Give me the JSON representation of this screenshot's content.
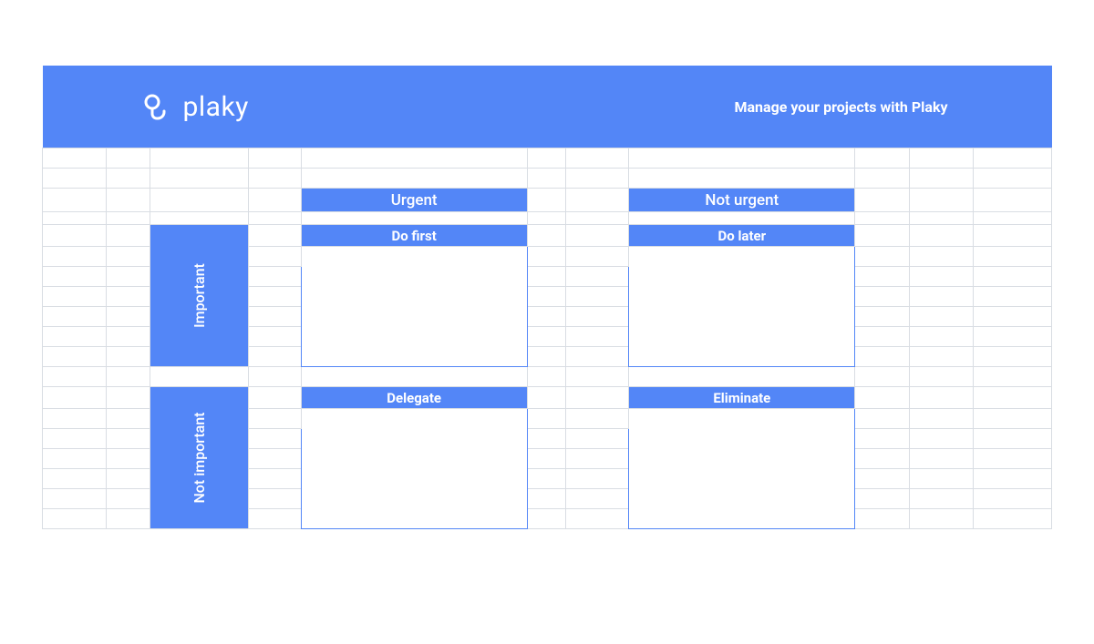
{
  "brand": {
    "name": "plaky"
  },
  "tagline": "Manage your projects with Plaky",
  "matrix": {
    "columns": {
      "left": "Urgent",
      "right": "Not urgent"
    },
    "rows": {
      "top": "Important",
      "bottom": "Not important"
    },
    "quadrants": {
      "top_left": {
        "title": "Do first"
      },
      "top_right": {
        "title": "Do later"
      },
      "bottom_left": {
        "title": "Delegate"
      },
      "bottom_right": {
        "title": "Eliminate"
      }
    }
  },
  "colors": {
    "accent": "#5386f7"
  }
}
